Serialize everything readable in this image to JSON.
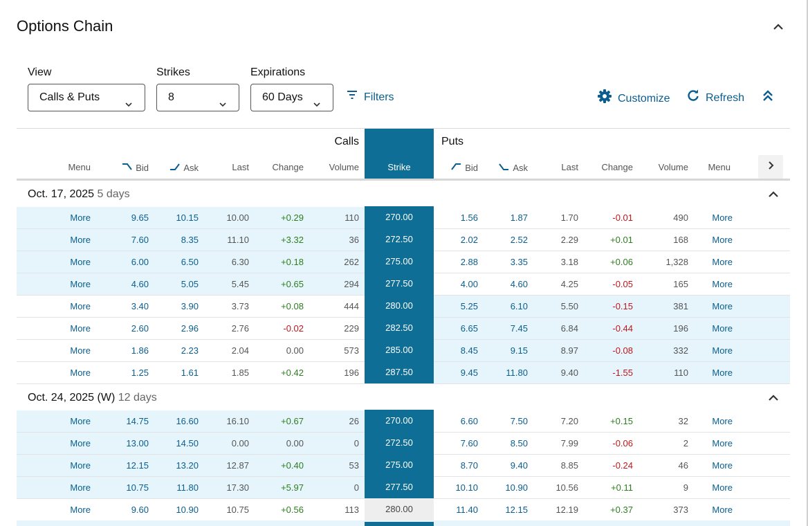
{
  "header": {
    "title": "Options Chain"
  },
  "controls": {
    "view": {
      "label": "View",
      "value": "Calls & Puts"
    },
    "strikes": {
      "label": "Strikes",
      "value": "8"
    },
    "expirations": {
      "label": "Expirations",
      "value": "60 Days"
    },
    "filters_label": "Filters",
    "customize_label": "Customize",
    "refresh_label": "Refresh"
  },
  "table": {
    "calls_title": "Calls",
    "puts_title": "Puts",
    "columns": {
      "menu": "Menu",
      "bid": "Bid",
      "ask": "Ask",
      "last": "Last",
      "change": "Change",
      "volume": "Volume",
      "strike": "Strike"
    },
    "groups": [
      {
        "label": "Oct. 17, 2025",
        "days": "5 days",
        "rows": [
          {
            "call_menu": "More",
            "call_bid": "9.65",
            "call_ask": "10.15",
            "call_last": "10.00",
            "call_change": "+0.29",
            "call_volume": "110",
            "strike": "270.00",
            "put_bid": "1.56",
            "put_ask": "1.87",
            "put_last": "1.70",
            "put_change": "-0.01",
            "put_volume": "490",
            "put_menu": "More"
          },
          {
            "call_menu": "More",
            "call_bid": "7.60",
            "call_ask": "8.35",
            "call_last": "11.10",
            "call_change": "+3.32",
            "call_volume": "36",
            "strike": "272.50",
            "put_bid": "2.02",
            "put_ask": "2.52",
            "put_last": "2.29",
            "put_change": "+0.01",
            "put_volume": "168",
            "put_menu": "More"
          },
          {
            "call_menu": "More",
            "call_bid": "6.00",
            "call_ask": "6.50",
            "call_last": "6.30",
            "call_change": "+0.18",
            "call_volume": "262",
            "strike": "275.00",
            "put_bid": "2.88",
            "put_ask": "3.35",
            "put_last": "3.18",
            "put_change": "+0.06",
            "put_volume": "1,328",
            "put_menu": "More"
          },
          {
            "call_menu": "More",
            "call_bid": "4.60",
            "call_ask": "5.05",
            "call_last": "5.45",
            "call_change": "+0.65",
            "call_volume": "294",
            "strike": "277.50",
            "put_bid": "4.00",
            "put_ask": "4.60",
            "put_last": "4.25",
            "put_change": "-0.05",
            "put_volume": "165",
            "put_menu": "More"
          },
          {
            "call_menu": "More",
            "call_bid": "3.40",
            "call_ask": "3.90",
            "call_last": "3.73",
            "call_change": "+0.08",
            "call_volume": "444",
            "strike": "280.00",
            "put_bid": "5.25",
            "put_ask": "6.10",
            "put_last": "5.50",
            "put_change": "-0.15",
            "put_volume": "381",
            "put_menu": "More"
          },
          {
            "call_menu": "More",
            "call_bid": "2.60",
            "call_ask": "2.96",
            "call_last": "2.76",
            "call_change": "-0.02",
            "call_volume": "229",
            "strike": "282.50",
            "put_bid": "6.65",
            "put_ask": "7.45",
            "put_last": "6.84",
            "put_change": "-0.44",
            "put_volume": "196",
            "put_menu": "More"
          },
          {
            "call_menu": "More",
            "call_bid": "1.86",
            "call_ask": "2.23",
            "call_last": "2.04",
            "call_change": "0.00",
            "call_volume": "573",
            "strike": "285.00",
            "put_bid": "8.45",
            "put_ask": "9.15",
            "put_last": "8.97",
            "put_change": "-0.08",
            "put_volume": "332",
            "put_menu": "More"
          },
          {
            "call_menu": "More",
            "call_bid": "1.25",
            "call_ask": "1.61",
            "call_last": "1.85",
            "call_change": "+0.42",
            "call_volume": "196",
            "strike": "287.50",
            "put_bid": "9.45",
            "put_ask": "11.80",
            "put_last": "9.40",
            "put_change": "-1.55",
            "put_volume": "110",
            "put_menu": "More"
          }
        ]
      },
      {
        "label": "Oct. 24, 2025 (W)",
        "days": "12 days",
        "rows": [
          {
            "call_menu": "More",
            "call_bid": "14.75",
            "call_ask": "16.60",
            "call_last": "16.10",
            "call_change": "+0.67",
            "call_volume": "26",
            "strike": "270.00",
            "put_bid": "6.60",
            "put_ask": "7.50",
            "put_last": "7.20",
            "put_change": "+0.15",
            "put_volume": "32",
            "put_menu": "More"
          },
          {
            "call_menu": "More",
            "call_bid": "13.00",
            "call_ask": "14.50",
            "call_last": "0.00",
            "call_change": "0.00",
            "call_volume": "0",
            "strike": "272.50",
            "put_bid": "7.60",
            "put_ask": "8.50",
            "put_last": "7.99",
            "put_change": "-0.06",
            "put_volume": "2",
            "put_menu": "More"
          },
          {
            "call_menu": "More",
            "call_bid": "12.15",
            "call_ask": "13.20",
            "call_last": "12.87",
            "call_change": "+0.40",
            "call_volume": "53",
            "strike": "275.00",
            "put_bid": "8.70",
            "put_ask": "9.40",
            "put_last": "8.85",
            "put_change": "-0.24",
            "put_volume": "46",
            "put_menu": "More"
          },
          {
            "call_menu": "More",
            "call_bid": "10.75",
            "call_ask": "11.80",
            "call_last": "17.30",
            "call_change": "+5.97",
            "call_volume": "0",
            "strike": "277.50",
            "put_bid": "10.10",
            "put_ask": "10.90",
            "put_last": "10.56",
            "put_change": "+0.11",
            "put_volume": "9",
            "put_menu": "More"
          },
          {
            "call_menu": "More",
            "call_bid": "9.60",
            "call_ask": "10.90",
            "call_last": "10.75",
            "call_change": "+0.56",
            "call_volume": "113",
            "strike": "280.00",
            "put_bid": "11.40",
            "put_ask": "12.15",
            "put_last": "12.19",
            "put_change": "+0.37",
            "put_volume": "373",
            "put_menu": "More"
          }
        ]
      }
    ]
  },
  "colors": {
    "accent": "#0a5d8e",
    "strike_bg": "#0e6e95",
    "itm_bg": "#e5f5fb",
    "positive": "#2e7d1f",
    "negative": "#c0161b"
  },
  "icons": [
    "chevron-up-icon",
    "chevron-down-icon",
    "filter-icon",
    "gear-icon",
    "refresh-icon",
    "double-chevron-up-icon",
    "chevron-right-icon",
    "bid-icon",
    "ask-icon"
  ]
}
